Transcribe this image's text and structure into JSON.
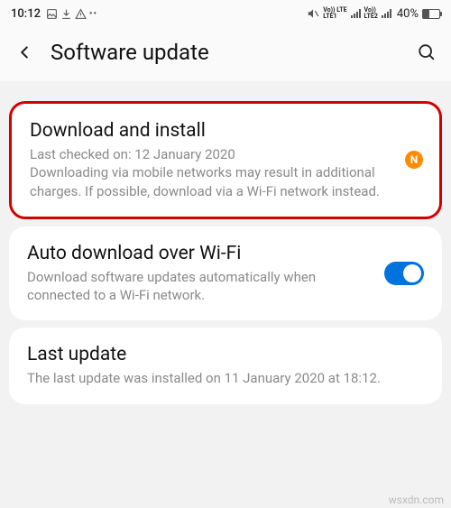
{
  "statusbar": {
    "time": "10:12",
    "net1": "Vo)) LTE\nLTE1",
    "net2": "Vo)) LTE\nLTE2",
    "battery": "40%"
  },
  "header": {
    "title": "Software update"
  },
  "download": {
    "title": "Download and install",
    "desc": "Last checked on: 12 January 2020\nDownloading via mobile networks may result in additional charges. If possible, download via a Wi-Fi network instead.",
    "badge": "N"
  },
  "auto": {
    "title": "Auto download over Wi-Fi",
    "desc": "Download software updates automatically when connected to a Wi-Fi network."
  },
  "last": {
    "title": "Last update",
    "desc": "The last update was installed on 11 January 2020 at 18:12."
  },
  "watermark": "wsxdn.com"
}
